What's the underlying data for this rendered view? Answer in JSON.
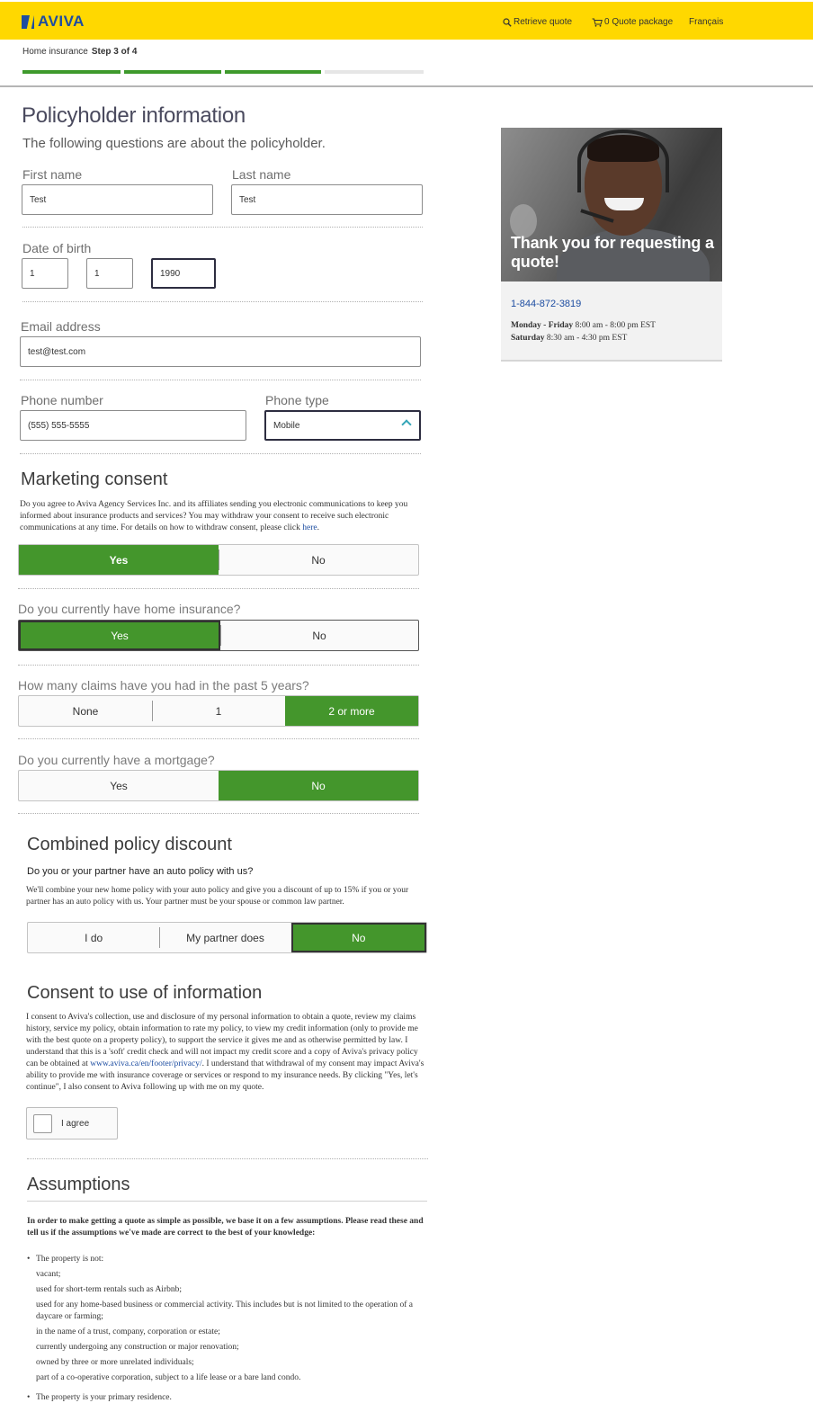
{
  "header": {
    "brand": "AVIVA",
    "retrieve_quote": "Retrieve quote",
    "quote_package": "0 Quote package",
    "language": "Français"
  },
  "progress": {
    "product": "Home insurance",
    "step": "Step 3 of 4",
    "steps_total": 4,
    "steps_completed": 3
  },
  "colors": {
    "brand_yellow": "#ffd800",
    "brand_blue": "#1d4da1",
    "selected_green": "#44962c"
  },
  "page": {
    "title": "Policyholder information",
    "subtitle": "The following questions are about the policyholder."
  },
  "form": {
    "first_name": {
      "label": "First name",
      "value": "Test"
    },
    "last_name": {
      "label": "Last name",
      "value": "Test"
    },
    "dob": {
      "label": "Date of birth",
      "day": "1",
      "month": "1",
      "year": "1990"
    },
    "email": {
      "label": "Email address",
      "value": "test@test.com"
    },
    "phone": {
      "label": "Phone number",
      "value": "(555) 555-5555"
    },
    "phone_type": {
      "label": "Phone type",
      "value": "Mobile"
    }
  },
  "marketing": {
    "heading": "Marketing consent",
    "text": "Do you agree to Aviva Agency Services Inc. and its affiliates sending you electronic communications to keep you informed about insurance products and services? You may withdraw your consent to receive such electronic communications at any time. For details on how to withdraw consent, please click",
    "link": "here",
    "yes": "Yes",
    "no": "No",
    "selected": "Yes"
  },
  "home_insurance": {
    "question": "Do you currently have home insurance?",
    "yes": "Yes",
    "no": "No",
    "selected": "Yes"
  },
  "claims": {
    "question": "How many claims have you had in the past 5 years?",
    "options": [
      "None",
      "1",
      "2 or more"
    ],
    "selected": "2 or more"
  },
  "mortgage": {
    "question": "Do you currently have a mortgage?",
    "yes": "Yes",
    "no": "No",
    "selected": "No"
  },
  "combined": {
    "heading": "Combined policy discount",
    "question": "Do you or your partner have an auto policy with us?",
    "text": "We'll combine your new home policy with your auto policy and give you a discount of up to 15% if you or your partner has an auto policy with us. Your partner must be your spouse or common law partner.",
    "options": [
      "I do",
      "My partner does",
      "No"
    ],
    "selected": "No"
  },
  "consent": {
    "heading": "Consent to use of information",
    "text_before": "I consent to Aviva's collection, use and disclosure of my personal information to obtain a quote, review my claims history, service my policy, obtain information to rate my policy, to view my credit information (only to provide me with the best quote on a property policy), to support the service it gives me and as otherwise permitted by law. I understand that this is a 'soft' credit check and will not impact my credit score and a copy of Aviva's privacy policy can be obtained at",
    "link": "www.aviva.ca/en/footer/privacy/",
    "text_after": ". I understand that withdrawal of my consent may impact Aviva's ability to provide me with insurance coverage or services or respond to my insurance needs. By clicking \"Yes, let's continue\", I also consent to Aviva following up with me on my quote.",
    "agree_label": "I agree",
    "agreed": false
  },
  "assumptions": {
    "heading": "Assumptions",
    "intro": "In order to make getting a quote as simple as possible, we base it on a few assumptions. Please read these and tell us if the assumptions we've made are correct to the best of your knowledge:",
    "property_not": "The property is not:",
    "items": [
      "vacant;",
      "used for short-term rentals such as Airbnb;",
      "used for any home-based business or commercial activity. This includes but is not limited to the operation of a daycare or farming;",
      "in the name of a trust, company, corporation or estate;",
      "currently undergoing any construction or major renovation;",
      "owned by three or more unrelated individuals;",
      "part of a co-operative corporation, subject to a life lease or a bare land condo."
    ],
    "primary": "The property is your primary residence."
  },
  "sidebar": {
    "caption": "Thank you for requesting a quote!",
    "phone": "1-844-872-3819",
    "weekday_label": "Monday - Friday",
    "weekday_hours": "8:00 am - 8:00 pm EST",
    "saturday_label": "Saturday",
    "saturday_hours": "8:30 am - 4:30 pm EST"
  }
}
